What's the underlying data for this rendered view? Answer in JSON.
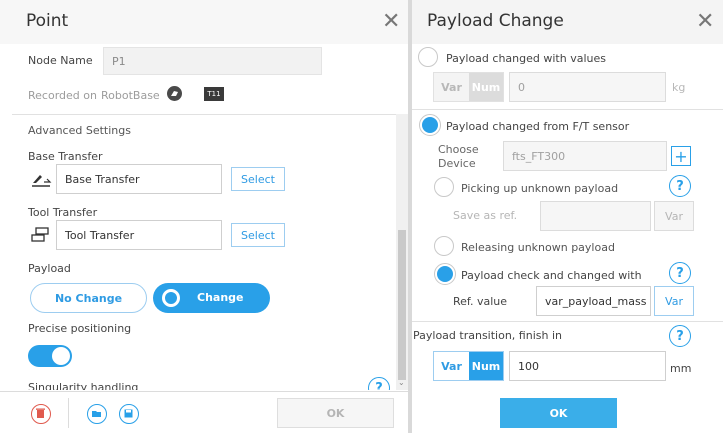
{
  "left": {
    "title": "Point",
    "node_name_label": "Node Name",
    "node_name_value": "P1",
    "recorded_on_label": "Recorded on",
    "recorded_on_value": "RobotBase",
    "recorded_badge": "T11",
    "advanced_settings": "Advanced Settings",
    "base_transfer_label": "Base Transfer",
    "base_transfer_value": "Base Transfer",
    "tool_transfer_label": "Tool Transfer",
    "tool_transfer_value": "Tool Transfer",
    "select_label": "Select",
    "payload_label": "Payload",
    "no_change_label": "No Change",
    "change_label": "Change",
    "precise_label": "Precise positioning",
    "singularity_label": "Singularity handling",
    "help_glyph": "?",
    "ok_label": "OK"
  },
  "right": {
    "title": "Payload Change",
    "opt1_label": "Payload changed with values",
    "var_label": "Var",
    "num_label": "Num",
    "value_input": "0",
    "unit_kg": "kg",
    "opt2_label": "Payload changed from F/T sensor",
    "choose_device_label": "Choose Device",
    "device_value": "fts_FT300",
    "add_glyph": "+",
    "picking_label": "Picking up unknown payload",
    "save_as_ref_label": "Save as ref.",
    "releasing_label": "Releasing unknown payload",
    "check_label": "Payload check and changed with",
    "ref_value_label": "Ref. value",
    "ref_value_input": "var_payload_mass",
    "transition_label": "Payload transition, finish in",
    "transition_value": "100",
    "unit_mm": "mm",
    "help_glyph": "?",
    "ok_label": "OK"
  },
  "close_glyph": "✕",
  "colors": {
    "accent": "#29a0e8",
    "ok_button": "#3aaee9",
    "delete_icon": "#e05a4e"
  }
}
